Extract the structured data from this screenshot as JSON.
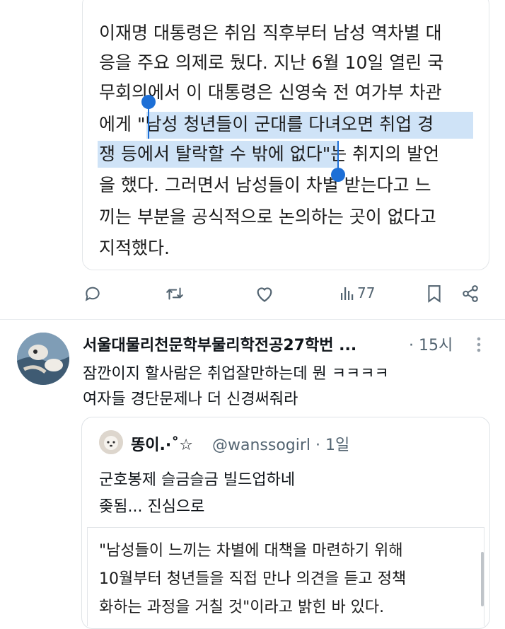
{
  "top_quote": {
    "lines": [
      "이재명 대통령은 취임 직후부터 남성 역차별 대",
      "응을 주요 의제로 뒀다. 지난 6월 10일 열린 국",
      "무회의에서 이 대통령은 신영숙 전 여가부 차관",
      "에게 \"남성 청년들이 군대를 다녀오면 취업 경",
      "쟁 등에서 탈락할 수 밖에 없다\"는 취지의 발언",
      "을 했다. 그러면서 남성들이 차별 받는다고 느",
      "끼는 부분을 공식적으로 논의하는 곳이 없다고",
      "지적했다."
    ]
  },
  "actions": {
    "reply_icon": "reply-icon",
    "retweet_icon": "retweet-icon",
    "like_icon": "heart-icon",
    "views_icon": "views-icon",
    "views_count": "77",
    "bookmark_icon": "bookmark-icon",
    "share_icon": "share-icon"
  },
  "tweet": {
    "author_name": "서울대물리천문학부물리학전공27학번 ...",
    "time": "· 15시",
    "body_lines": [
      "잠깐이지 할사람은 취업잘만하는데 뭔 ㅋㅋㅋㅋ",
      "여자들 경단문제나 더 신경써줘라"
    ],
    "quote": {
      "name": "똥이.·˚☆",
      "handle_time": "@wanssogirl · 1일",
      "lines": [
        "군호봉제 슬금슬금 빌드업하네",
        "좆됨... 진심으로"
      ],
      "inner_lines": [
        "\"남성들이 느끼는 차별에 대책을 마련하기 위해",
        "10월부터 청년들을 직접 만나 의견을 듣고 정책",
        "화하는 과정을 거칠 것\"이라고 밝힌 바 있다."
      ]
    }
  },
  "colors": {
    "highlight": "#cfe3f7",
    "selection_handle": "#1d6fd6",
    "secondary_text": "#536471"
  }
}
